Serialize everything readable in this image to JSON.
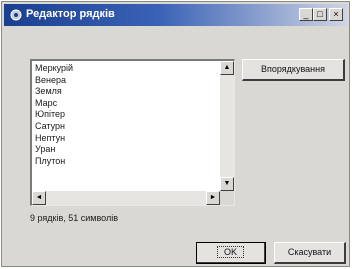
{
  "window": {
    "title": "Редактор рядків",
    "title_icon": "gear-icon",
    "minimize_glyph": "_",
    "maximize_glyph": "□",
    "close_glyph": "×"
  },
  "list": {
    "items": [
      "Меркурій",
      "Венера",
      "Земля",
      "Марс",
      "Юпітер",
      "Сатурн",
      "Нептун",
      "Уран",
      "Плутон"
    ],
    "scroll_up_glyph": "▲",
    "scroll_down_glyph": "▼",
    "scroll_left_glyph": "◄",
    "scroll_right_glyph": "►"
  },
  "sort_button": "Впорядкування",
  "status": "9 рядків, 51 символів",
  "buttons": {
    "ok": "OK",
    "cancel": "Скасувати"
  }
}
